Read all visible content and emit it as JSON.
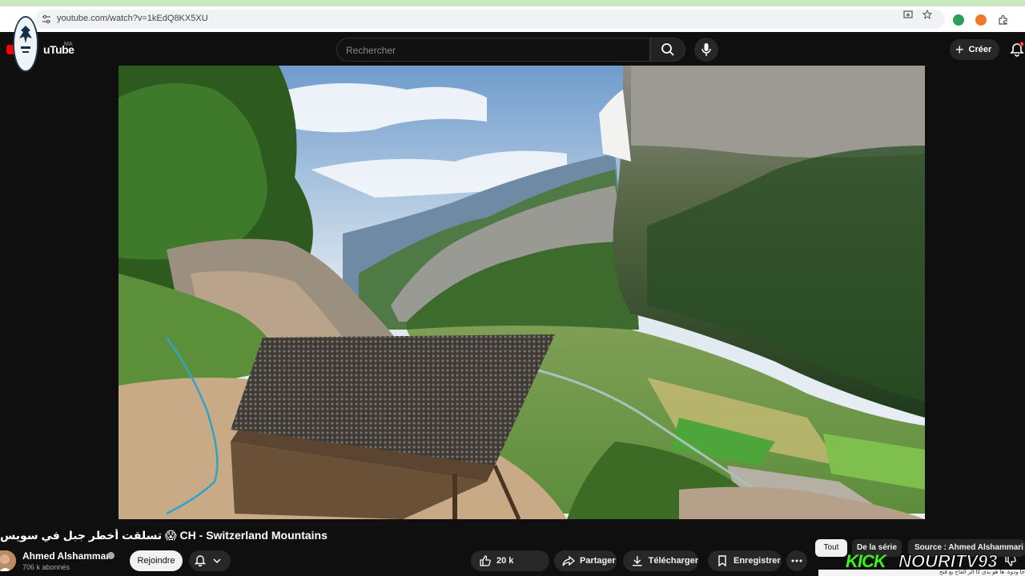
{
  "browser": {
    "url": "youtube.com/watch?v=1kEdQ8KX5XU",
    "icons": [
      "back-arrow-icon",
      "tune-icon",
      "install-app-icon",
      "star-bookmark-icon",
      "extension-badge-icon",
      "brave-icon",
      "puzzle-extensions-icon"
    ]
  },
  "header": {
    "logo_text": "uTube",
    "region": "MA",
    "search_placeholder": "Rechercher",
    "create_label": "Créer",
    "notification_count": "9"
  },
  "video": {
    "title_arabic": "تسلقت أخطر جبل في سويس",
    "title_suffix": "CH - Switzerland Mountains",
    "title_emoji": "😱"
  },
  "channel": {
    "name": "Ahmed Alshammari",
    "subscribers": "706 k abonnés",
    "join_label": "Rejoindre"
  },
  "actions": {
    "likes": "20 k",
    "share": "Partager",
    "download": "Télécharger",
    "save": "Enregistrer"
  },
  "chips": {
    "all": "Tout",
    "series": "De la série",
    "source": "Source : Ahmed Alshammari"
  },
  "watermark": {
    "kick": "KICK",
    "name": "NOURITV93",
    "ticker": "جا ودوة. ها هو بدي كا الر الفاح بع فتح"
  },
  "colors": {
    "background": "#0f0f0f",
    "accent_red": "#ff0000",
    "kick_green": "#3cf01f"
  }
}
